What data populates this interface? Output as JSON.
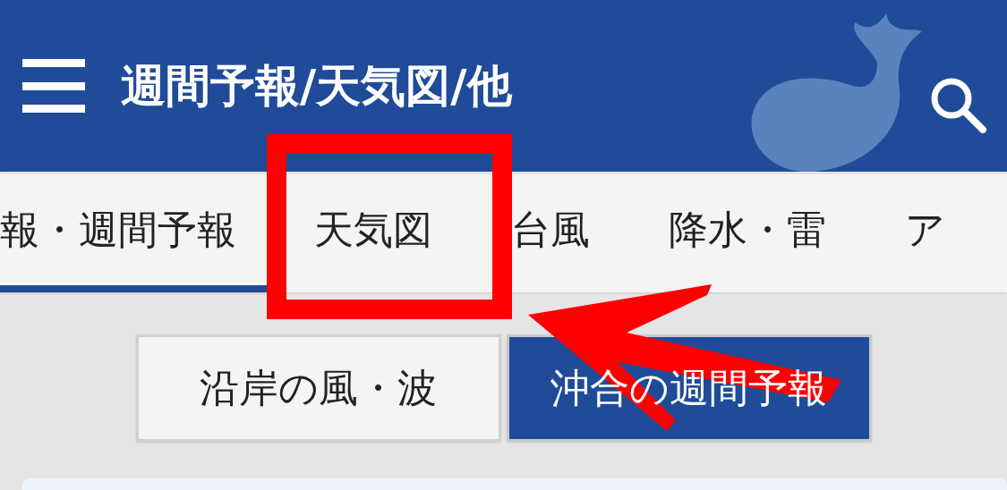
{
  "header": {
    "title": "週間予報/天気図/他"
  },
  "tabs": [
    {
      "label": "報・週間予報",
      "selected": true
    },
    {
      "label": "天気図",
      "selected": false
    },
    {
      "label": "台風",
      "selected": false
    },
    {
      "label": "降水・雷",
      "selected": false
    },
    {
      "label": "ア",
      "selected": false
    }
  ],
  "segments": [
    {
      "label": "沿岸の風・波",
      "selected": false
    },
    {
      "label": "沖合の週間予報",
      "selected": true
    }
  ]
}
